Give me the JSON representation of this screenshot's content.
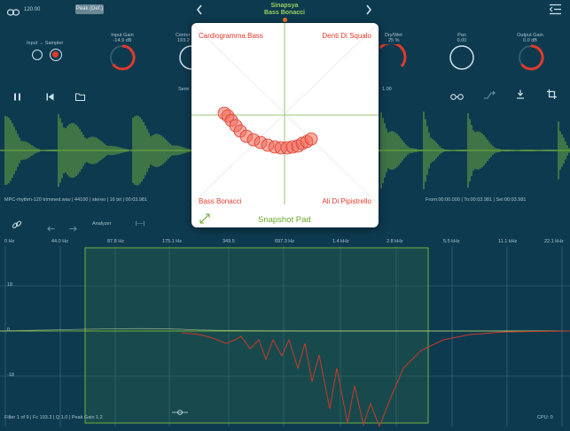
{
  "topbar": {
    "bpm": "120.00",
    "preset_button": "Peak (Def.)",
    "title": "Sinapsya",
    "subtitle": "Bass Bonacci"
  },
  "controls": {
    "input_label": "Input → Sampler",
    "input_gain": {
      "label": "Input Gain",
      "value": "-14.9 dB",
      "level": 0.75
    },
    "center": {
      "label": "Center",
      "value": "193.2"
    },
    "drywet": {
      "label": "Dry/Wet",
      "value": "25 %",
      "level": 0.6
    },
    "pan": {
      "label": "Pan",
      "value": "0.00"
    },
    "output_gain": {
      "label": "Output Gain",
      "value": "0.0 dB",
      "level": 0.72
    },
    "semi_label": "Semi",
    "right_value": "1.00"
  },
  "file_info": {
    "left": "MPC-rhythm-120 trimmed.wav | 44100 | stereo | 16 bit | 00:03.981",
    "right": "From:00:00.000 | To:00:03.981 | Sel:00:03.981"
  },
  "analyzer": {
    "label": "Analyzer",
    "bracket": "[----]",
    "freq_labels": [
      "0 Hz",
      "44.0 Hz",
      "87.8 Hz",
      "175.1 Hz",
      "349.5",
      "697.3 Hz",
      "1.4 kHz",
      "2.8 kHz",
      "5.5 kHz",
      "11.1 kHz",
      "22.1 kHz"
    ],
    "db_labels": [
      "18",
      "0",
      "-18"
    ],
    "filter_info": "Filter 1 of 9 | Fc 193.3 | Q 1.0 | Peak Gain 1.2",
    "cpu": "CPU: 0"
  },
  "snapshot_pad": {
    "top_left": "Cardiogramma Bass",
    "top_right": "Denti Di Squalo",
    "bottom_left": "Bass Bonacci",
    "bottom_right": "Ali Di Pipistrello",
    "title": "Snapshot Pad"
  },
  "colors": {
    "background": "#0e3a50",
    "accent_red": "#e23a2a",
    "wave_green": "#6fae3c",
    "pad_green": "#6aaa2a"
  }
}
